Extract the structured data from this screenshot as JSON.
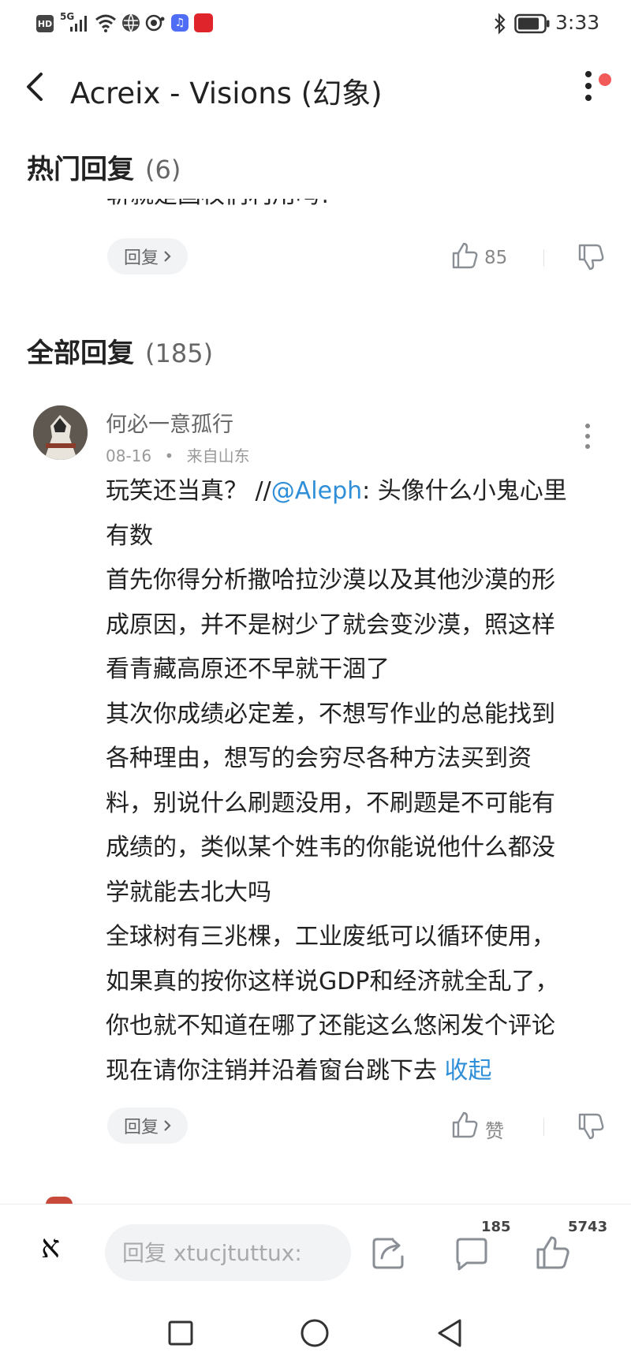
{
  "status_bar": {
    "network_badges": [
      "HD",
      "5G"
    ],
    "time": "3:33"
  },
  "header": {
    "title": "Acreix - Visions (幻象)"
  },
  "hot_replies": {
    "title": "热门回复",
    "count": "(6)",
    "clipped_text": "斩就是国权们利用吗?",
    "reply_label": "回复",
    "like_count": "85"
  },
  "all_replies": {
    "title": "全部回复",
    "count": "(185)"
  },
  "comment": {
    "username": "何必一意孤行",
    "date": "08-16",
    "separator": "•",
    "location": "来自山东",
    "line1_prefix": "玩笑还当真？ //",
    "mention": "@Aleph",
    "line1_suffix": ": 头像什么小鬼心里",
    "lines": [
      "有数",
      "首先你得分析撒哈拉沙漠以及其他沙漠的形",
      "成原因，并不是树少了就会变沙漠，照这样",
      "看青藏高原还不早就干涸了",
      "其次你成绩必定差，不想写作业的总能找到",
      "各种理由，想写的会穷尽各种方法买到资",
      "料，别说什么刷题没用，不刷题是不可能有",
      "成绩的，类似某个姓韦的你能说他什么都没",
      "学就能去北大吗",
      "全球树有三兆棵，工业废纸可以循环使用，",
      "如果真的按你这样说GDP和经济就全乱了，",
      "你也就不知道在哪了还能这么悠闲发个评论"
    ],
    "last_line": "现在请你注销并沿着窗台跳下去",
    "collapse_label": "收起",
    "reply_label": "回复",
    "like_label": "赞"
  },
  "bottom_bar": {
    "logo_glyph": "א",
    "reply_placeholder": "回复 xtucjtuttux:",
    "comment_count": "185",
    "like_count": "5743"
  },
  "colors": {
    "link": "#2e8fd8",
    "notification_dot": "#f25a5a",
    "app_icon_red": "#e0242b",
    "music_icon_blue": "#4f6df5"
  }
}
